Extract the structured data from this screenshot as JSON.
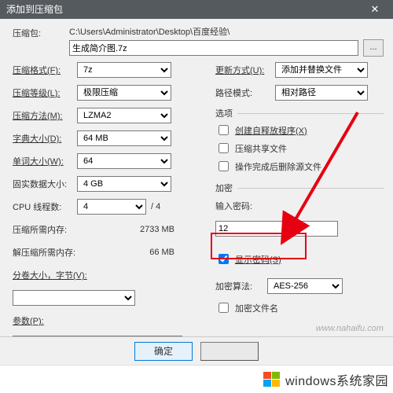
{
  "title": "添加到压缩包",
  "archive": {
    "label": "压缩包:",
    "path": "C:\\Users\\Administrator\\Desktop\\百度经验\\",
    "filename": "生成简介图.7z",
    "browse": "..."
  },
  "left": {
    "format": {
      "label": "压缩格式(F):",
      "value": "7z"
    },
    "level": {
      "label": "压缩等级(L):",
      "value": "极限压缩"
    },
    "method": {
      "label": "压缩方法(M):",
      "value": "LZMA2"
    },
    "dict": {
      "label": "字典大小(D):",
      "value": "64 MB"
    },
    "word": {
      "label": "单词大小(W):",
      "value": "64"
    },
    "solid": {
      "label": "固实数据大小:",
      "value": "4 GB"
    },
    "threads": {
      "label": "CPU 线程数:",
      "value": "4",
      "suffix": "/ 4"
    },
    "mem_comp": {
      "label": "压缩所需内存:",
      "value": "2733 MB"
    },
    "mem_decomp": {
      "label": "解压缩所需内存:",
      "value": "66 MB"
    },
    "split": {
      "label": "分卷大小，字节(V):",
      "value": ""
    },
    "params": {
      "label": "参数(P):",
      "value": ""
    }
  },
  "right": {
    "update": {
      "label": "更新方式(U):",
      "value": "添加并替换文件"
    },
    "pathmode": {
      "label": "路径模式:",
      "value": "相对路径"
    },
    "options_hdr": "选项",
    "opt_sfx": {
      "label": "创建自释放程序(X)",
      "checked": false
    },
    "opt_share": {
      "label": "压缩共享文件",
      "checked": false
    },
    "opt_delete": {
      "label": "操作完成后删除源文件",
      "checked": false
    },
    "enc_hdr": "加密",
    "pwd_label": "输入密码:",
    "pwd_value": "12",
    "show_pwd": {
      "label": "显示密码(S)",
      "checked": true
    },
    "algo": {
      "label": "加密算法:",
      "value": "AES-256"
    },
    "enc_names": {
      "label": "加密文件名",
      "checked": false
    }
  },
  "footer": {
    "ok": "确定"
  },
  "watermark": "www.nahaifu.com",
  "brand": "windows系统家园"
}
